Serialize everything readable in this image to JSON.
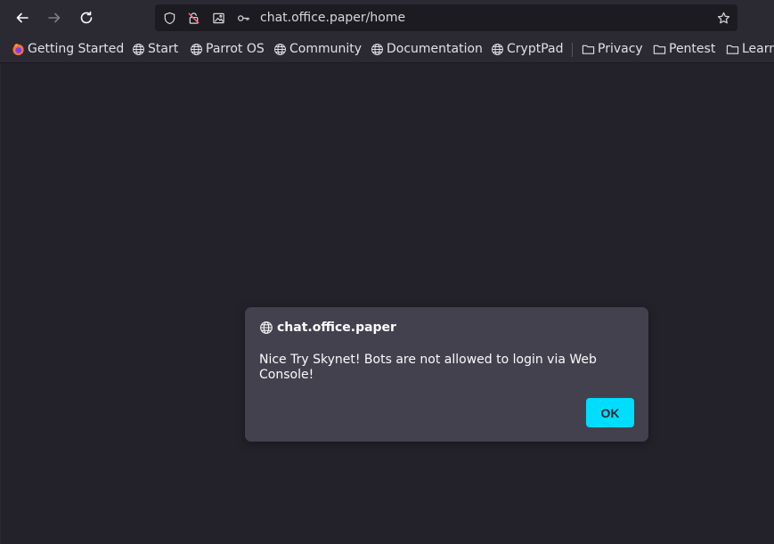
{
  "browser": {
    "url": "chat.office.paper/home",
    "icons": {
      "back": "arrow-left-icon",
      "forward": "arrow-right-icon",
      "reload": "reload-icon",
      "shield": "shield-icon",
      "permissions": "blocked-permission-icon",
      "image": "image-icon",
      "key": "key-icon",
      "bookmark": "star-icon"
    }
  },
  "bookmarks": [
    {
      "label": "Getting Started",
      "icon": "firefox-icon"
    },
    {
      "label": "Start",
      "icon": "globe-icon"
    },
    {
      "label": "Parrot OS",
      "icon": "globe-icon"
    },
    {
      "label": "Community",
      "icon": "globe-icon"
    },
    {
      "label": "Documentation",
      "icon": "globe-icon"
    },
    {
      "label": "CryptPad",
      "icon": "globe-icon"
    },
    {
      "label": "Privacy",
      "icon": "folder-icon"
    },
    {
      "label": "Pentest",
      "icon": "folder-icon"
    },
    {
      "label": "Learn",
      "icon": "folder-icon"
    }
  ],
  "dialog": {
    "title": "chat.office.paper",
    "message": "Nice Try Skynet! Bots are not allowed to login via Web Console!",
    "ok_label": "OK"
  },
  "colors": {
    "background": "#2b2a33",
    "content": "#23222b",
    "dialog": "#42414d",
    "accent": "#00ddff"
  }
}
